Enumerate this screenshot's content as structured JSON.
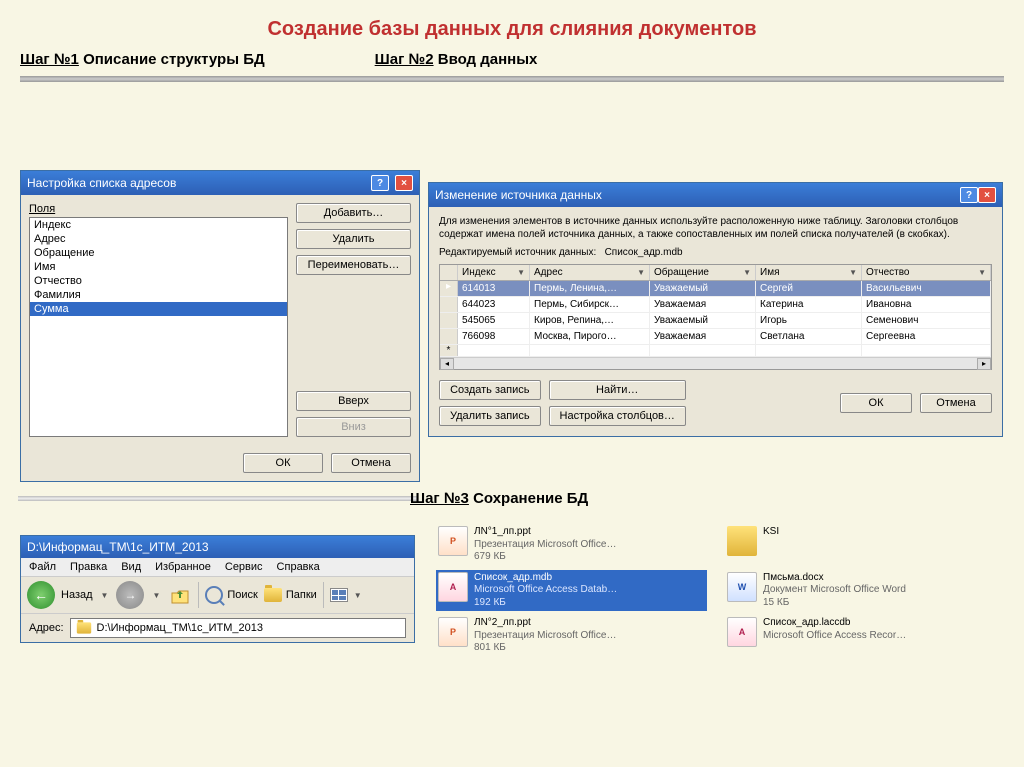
{
  "page": {
    "title": "Создание базы данных для слияния документов"
  },
  "steps": {
    "s1_label": "Шаг №1",
    "s1_suffix": " Описание структуры БД",
    "s2_label": "Шаг №2",
    "s2_suffix": " Ввод данных",
    "s3_label": "Шаг №3",
    "s3_suffix": " Сохранение БД"
  },
  "dlg1": {
    "title": "Настройка списка адресов",
    "fields_label": "Поля",
    "items": {
      "i0": "Индекс",
      "i1": "Адрес",
      "i2": "Обращение",
      "i3": "Имя",
      "i4": "Отчество",
      "i5": "Фамилия",
      "i6": "Сумма"
    },
    "btns": {
      "add": "Добавить…",
      "del": "Удалить",
      "ren": "Переименовать…",
      "up": "Вверх",
      "down": "Вниз",
      "ok": "ОК",
      "cancel": "Отмена"
    }
  },
  "dlg2": {
    "title": "Изменение источника данных",
    "desc": "Для изменения элементов в источнике данных используйте расположенную ниже таблицу. Заголовки столбцов содержат имена полей источника данных, а также сопоставленных им полей списка получателей (в скобках).",
    "src_label": "Редактируемый источник данных:",
    "src_value": "Список_адр.mdb",
    "cols": {
      "c0": "Индекс",
      "c1": "Адрес",
      "c2": "Обращение",
      "c3": "Имя",
      "c4": "Отчество"
    },
    "rows": {
      "r0": {
        "c0": "614013",
        "c1": "Пермь, Ленина,…",
        "c2": "Уважаемый",
        "c3": "Сергей",
        "c4": "Васильевич"
      },
      "r1": {
        "c0": "644023",
        "c1": "Пермь, Сибирск…",
        "c2": "Уважаемая",
        "c3": "Катерина",
        "c4": "Ивановна"
      },
      "r2": {
        "c0": "545065",
        "c1": "Киров, Репина,…",
        "c2": "Уважаемый",
        "c3": "Игорь",
        "c4": "Семенович"
      },
      "r3": {
        "c0": "766098",
        "c1": "Москва, Пирого…",
        "c2": "Уважаемая",
        "c3": "Светлана",
        "c4": "Сергеевна"
      }
    },
    "btns": {
      "new": "Создать запись",
      "find": "Найти…",
      "del": "Удалить запись",
      "cols": "Настройка столбцов…",
      "ok": "ОК",
      "cancel": "Отмена"
    }
  },
  "explorer": {
    "title": "D:\\Информац_ТМ\\1с_ИТМ_2013",
    "menu": {
      "m0": "Файл",
      "m1": "Правка",
      "m2": "Вид",
      "m3": "Избранное",
      "m4": "Сервис",
      "m5": "Справка"
    },
    "back": "Назад",
    "search": "Поиск",
    "folders": "Папки",
    "addr_label": "Адрес:",
    "addr_value": "D:\\Информац_ТМ\\1с_ИТМ_2013"
  },
  "files": {
    "f0": {
      "name": "ЛN°1_лп.ppt",
      "sub": "Презентация Microsoft Office…",
      "size": "679 КБ"
    },
    "f1": {
      "name": "KSI",
      "sub": "",
      "size": ""
    },
    "f2": {
      "name": "Список_адр.mdb",
      "sub": "Microsoft Office Access Datab…",
      "size": "192 КБ"
    },
    "f3": {
      "name": "Пмсьма.docx",
      "sub": "Документ Microsoft Office Word",
      "size": "15 КБ"
    },
    "f4": {
      "name": "ЛN°2_лп.ppt",
      "sub": "Презентация Microsoft Office…",
      "size": "801 КБ"
    },
    "f5": {
      "name": "Список_адр.laccdb",
      "sub": "Microsoft Office Access Recor…",
      "size": ""
    }
  }
}
